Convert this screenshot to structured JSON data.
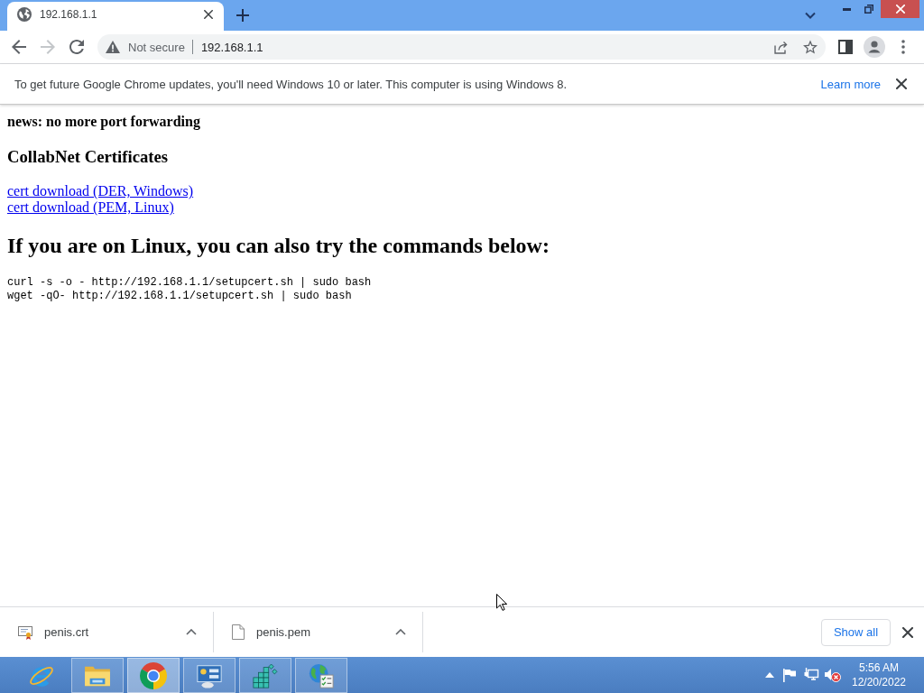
{
  "tabs": [
    {
      "title": "192.168.1.1",
      "selected": true
    }
  ],
  "toolbar": {
    "buttons": [
      {
        "kind": "back",
        "disabled": false
      },
      {
        "kind": "forward",
        "disabled": true
      },
      {
        "kind": "reload",
        "disabled": false
      }
    ]
  },
  "address_bar": {
    "security": "Not secure",
    "url": "192.168.1.1"
  },
  "info_bar": {
    "message": "To get future Google Chrome updates, you'll need Windows 10 or later. This computer is using Windows 8.",
    "link": "Learn more"
  },
  "page": {
    "blocks": [
      {
        "kind": "bold",
        "text": "news: no more port forwarding"
      },
      {
        "kind": "heading3",
        "text": "CollabNet Certificates"
      },
      {
        "kind": "links",
        "items": [
          "cert download (DER, Windows)",
          "cert download (PEM, Linux)"
        ]
      },
      {
        "kind": "heading2",
        "text": "If you are on Linux, you can also try the commands below:"
      },
      {
        "kind": "code",
        "lines": [
          "curl -s -o - http://192.168.1.1/setupcert.sh | sudo bash",
          "wget -qO- http://192.168.1.1/setupcert.sh | sudo bash"
        ]
      }
    ]
  },
  "downloads": {
    "items": [
      {
        "kind": "certificate",
        "filename": "penis.crt"
      },
      {
        "kind": "document",
        "filename": "penis.pem"
      }
    ],
    "show_all": "Show all"
  },
  "taskbar": {
    "apps": [
      {
        "kind": "internet-explorer",
        "open": false,
        "selected": false
      },
      {
        "kind": "file-explorer",
        "open": true,
        "selected": false
      },
      {
        "kind": "chrome",
        "open": true,
        "selected": true
      },
      {
        "kind": "control-panel",
        "open": true,
        "selected": false
      },
      {
        "kind": "cubes",
        "open": true,
        "selected": false
      },
      {
        "kind": "globe-checklist",
        "open": true,
        "selected": false
      }
    ],
    "clock": {
      "time": "5:56 AM",
      "date": "12/20/2022"
    }
  }
}
